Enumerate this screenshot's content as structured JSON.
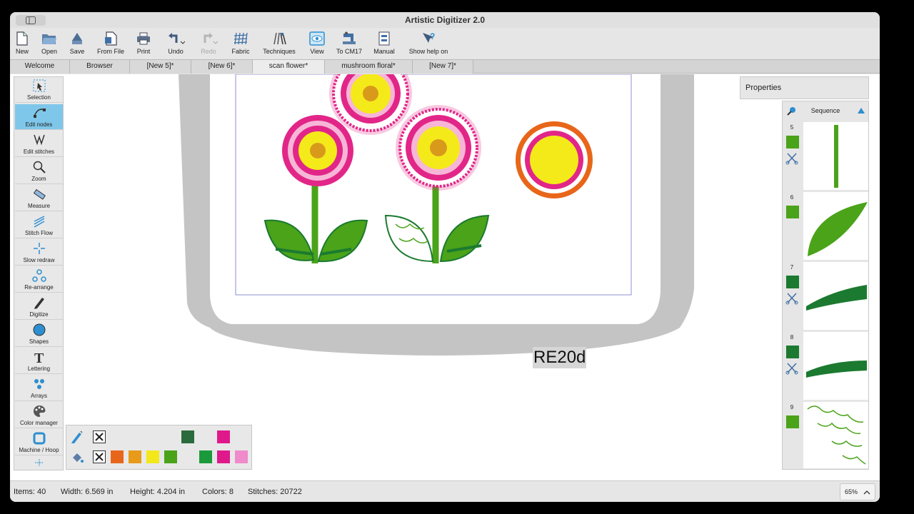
{
  "window": {
    "title": "Artistic Digitizer 2.0"
  },
  "toolbar": {
    "new": "New",
    "open": "Open",
    "save": "Save",
    "from_file": "From File",
    "print": "Print",
    "undo": "Undo",
    "redo": "Redo",
    "fabric": "Fabric",
    "techniques": "Techniques",
    "view": "View",
    "to_cm17": "To CM17",
    "manual": "Manual",
    "show_help": "Show help on"
  },
  "tabs": [
    "Welcome",
    "Browser",
    "[New 5]*",
    "[New 6]*",
    "scan flower*",
    "mushroom floral*",
    "[New 7]*"
  ],
  "active_tab": "scan flower*",
  "tools": {
    "selection": "Selection",
    "edit_nodes": "Edit nodes",
    "edit_stitches": "Edit stitches",
    "zoom": "Zoom",
    "measure": "Measure",
    "stitch_flow": "Stitch Flow",
    "slow_redraw": "Slow redraw",
    "rearrange": "Re-arrange",
    "digitize": "Digitize",
    "shapes": "Shapes",
    "lettering": "Lettering",
    "arrays": "Arrays",
    "color_manager": "Color manager",
    "machine_hoop": "Machine / Hoop"
  },
  "canvas": {
    "hoop_label": "RE20d"
  },
  "properties": {
    "header": "Properties"
  },
  "sequence": {
    "header": "Sequence",
    "items": [
      {
        "num": "5",
        "color": "#4aa319",
        "has_cut": true
      },
      {
        "num": "6",
        "color": "#4aa319",
        "has_cut": false
      },
      {
        "num": "7",
        "color": "#1b7a30",
        "has_cut": true
      },
      {
        "num": "8",
        "color": "#1b7a30",
        "has_cut": true
      },
      {
        "num": "9",
        "color": "#4aa319",
        "has_cut": false
      }
    ]
  },
  "palette": {
    "row1": [
      "#2a6b3d",
      "#e0198a"
    ],
    "row2": [
      "#e8661a",
      "#e89a1a",
      "#f2e81a",
      "#4aa319",
      "#1a9a3a",
      "#e0198a",
      "#ef8acb"
    ]
  },
  "status": {
    "items": "Items: 40",
    "width": "Width: 6.569 in",
    "height": "Height: 4.204 in",
    "colors": "Colors: 8",
    "stitches": "Stitches: 20722",
    "zoom": "65%"
  },
  "colors": {
    "accent": "#7fc7ea",
    "selection_blue": "#1e8fd8"
  }
}
